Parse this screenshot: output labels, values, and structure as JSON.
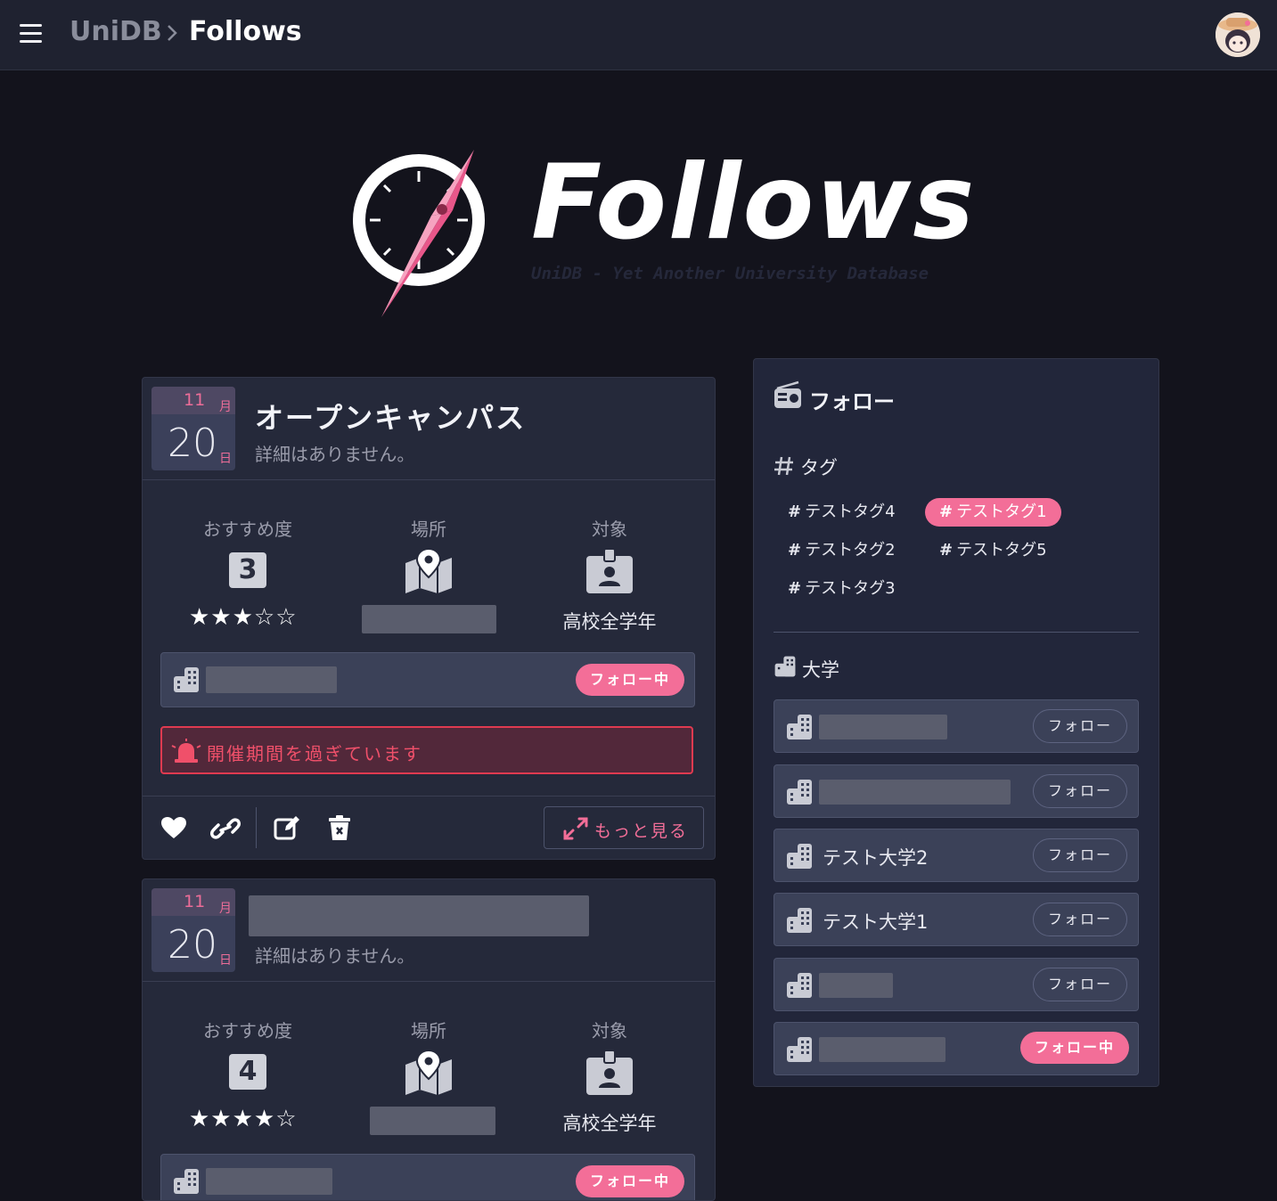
{
  "header": {
    "breadcrumb_root": "UniDB",
    "breadcrumb_separator": ">",
    "breadcrumb_current": "Follows"
  },
  "hero": {
    "wordmark": "Follows",
    "tagline": "UniDB - Yet Another University Database"
  },
  "cards": [
    {
      "month": "11",
      "month_label": "月",
      "day": "20",
      "day_label": "日",
      "title": "オープンキャンパス",
      "description": "詳細はありません。",
      "recommend_label": "おすすめ度",
      "recommend_value": "3",
      "stars": "★★★☆☆",
      "rating": 3,
      "place_label": "場所",
      "target_label": "対象",
      "target_value": "高校全学年",
      "follow_status": "フォロー中",
      "warning": "開催期間を過ぎています",
      "more_label": "もっと見る"
    },
    {
      "month": "11",
      "month_label": "月",
      "day": "20",
      "day_label": "日",
      "description": "詳細はありません。",
      "recommend_label": "おすすめ度",
      "recommend_value": "4",
      "stars": "★★★★☆",
      "rating": 4,
      "place_label": "場所",
      "target_label": "対象",
      "target_value": "高校全学年",
      "follow_status": "フォロー中"
    }
  ],
  "sidebar": {
    "title": "フォロー",
    "tags_title": "タグ",
    "tags": [
      {
        "label": "テストタグ4",
        "active": false
      },
      {
        "label": "テストタグ1",
        "active": true
      },
      {
        "label": "テストタグ2",
        "active": false
      },
      {
        "label": "テストタグ5",
        "active": false
      },
      {
        "label": "テストタグ3",
        "active": false
      }
    ],
    "hash": "#",
    "universities_title": "大学",
    "universities": [
      {
        "name": "",
        "button": "フォロー",
        "following": false
      },
      {
        "name": "",
        "button": "フォロー",
        "following": false
      },
      {
        "name": "テスト大学2",
        "button": "フォロー",
        "following": false
      },
      {
        "name": "テスト大学1",
        "button": "フォロー",
        "following": false
      },
      {
        "name": "",
        "button": "フォロー",
        "following": false
      },
      {
        "name": "",
        "button": "フォロー中",
        "following": true
      }
    ]
  },
  "colors": {
    "accent": "#f36e98",
    "background": "#13131c",
    "panel": "#25293a",
    "warning": "#e03a50"
  }
}
